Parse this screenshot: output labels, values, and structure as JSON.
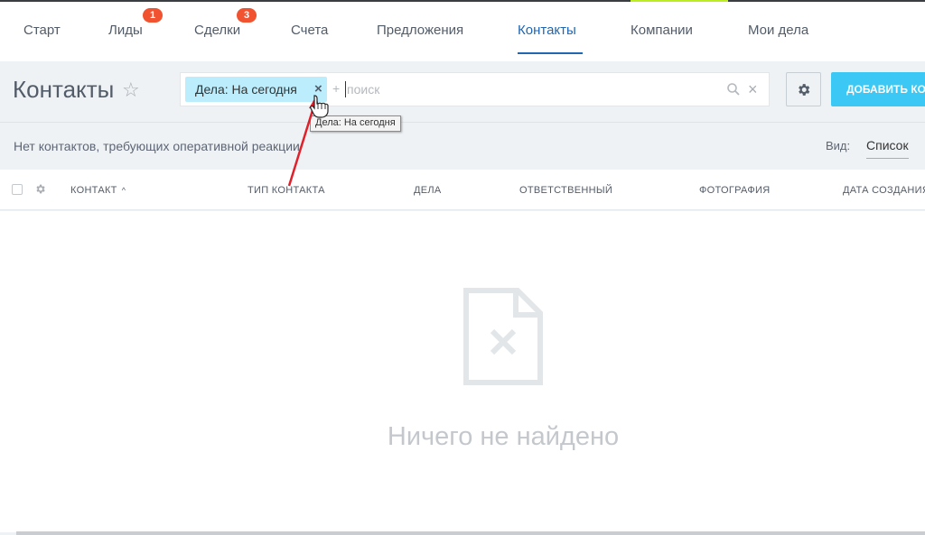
{
  "nav": {
    "items": [
      {
        "label": "Старт"
      },
      {
        "label": "Лиды",
        "badge": "1"
      },
      {
        "label": "Сделки",
        "badge": "3"
      },
      {
        "label": "Счета"
      },
      {
        "label": "Предложения"
      },
      {
        "label": "Контакты",
        "active": true
      },
      {
        "label": "Компании"
      },
      {
        "label": "Мои дела"
      }
    ]
  },
  "page": {
    "title": "Контакты",
    "star": "☆"
  },
  "filter": {
    "chip_label": "Дела: На сегодня",
    "chip_close": "×",
    "plus": "+",
    "placeholder": "поиск",
    "clear": "×",
    "tooltip": "Дела: На сегодня"
  },
  "toolbar": {
    "add_label": "ДОБАВИТЬ КОНТАКТ"
  },
  "info": {
    "message": "Нет контактов, требующих оперативной реакции",
    "view_label": "Вид:",
    "view_value": "Список"
  },
  "table": {
    "columns": [
      "КОНТАКТ",
      "ТИП КОНТАКТА",
      "ДЕЛА",
      "ОТВЕТСТВЕННЫЙ",
      "ФОТОГРАФИЯ",
      "ДАТА СОЗДАНИЯ"
    ],
    "sort_indicator": "^",
    "empty_text": "Ничего не найдено"
  },
  "colors": {
    "accent": "#2066b0",
    "add_button": "#3bc8f5",
    "chip": "#bcedfc",
    "badge": "#f1522f",
    "annotation_arrow": "#e0212b"
  },
  "icons": [
    "star-icon",
    "search-icon",
    "close-icon",
    "gear-icon",
    "empty-document-icon",
    "hand-cursor-icon"
  ]
}
